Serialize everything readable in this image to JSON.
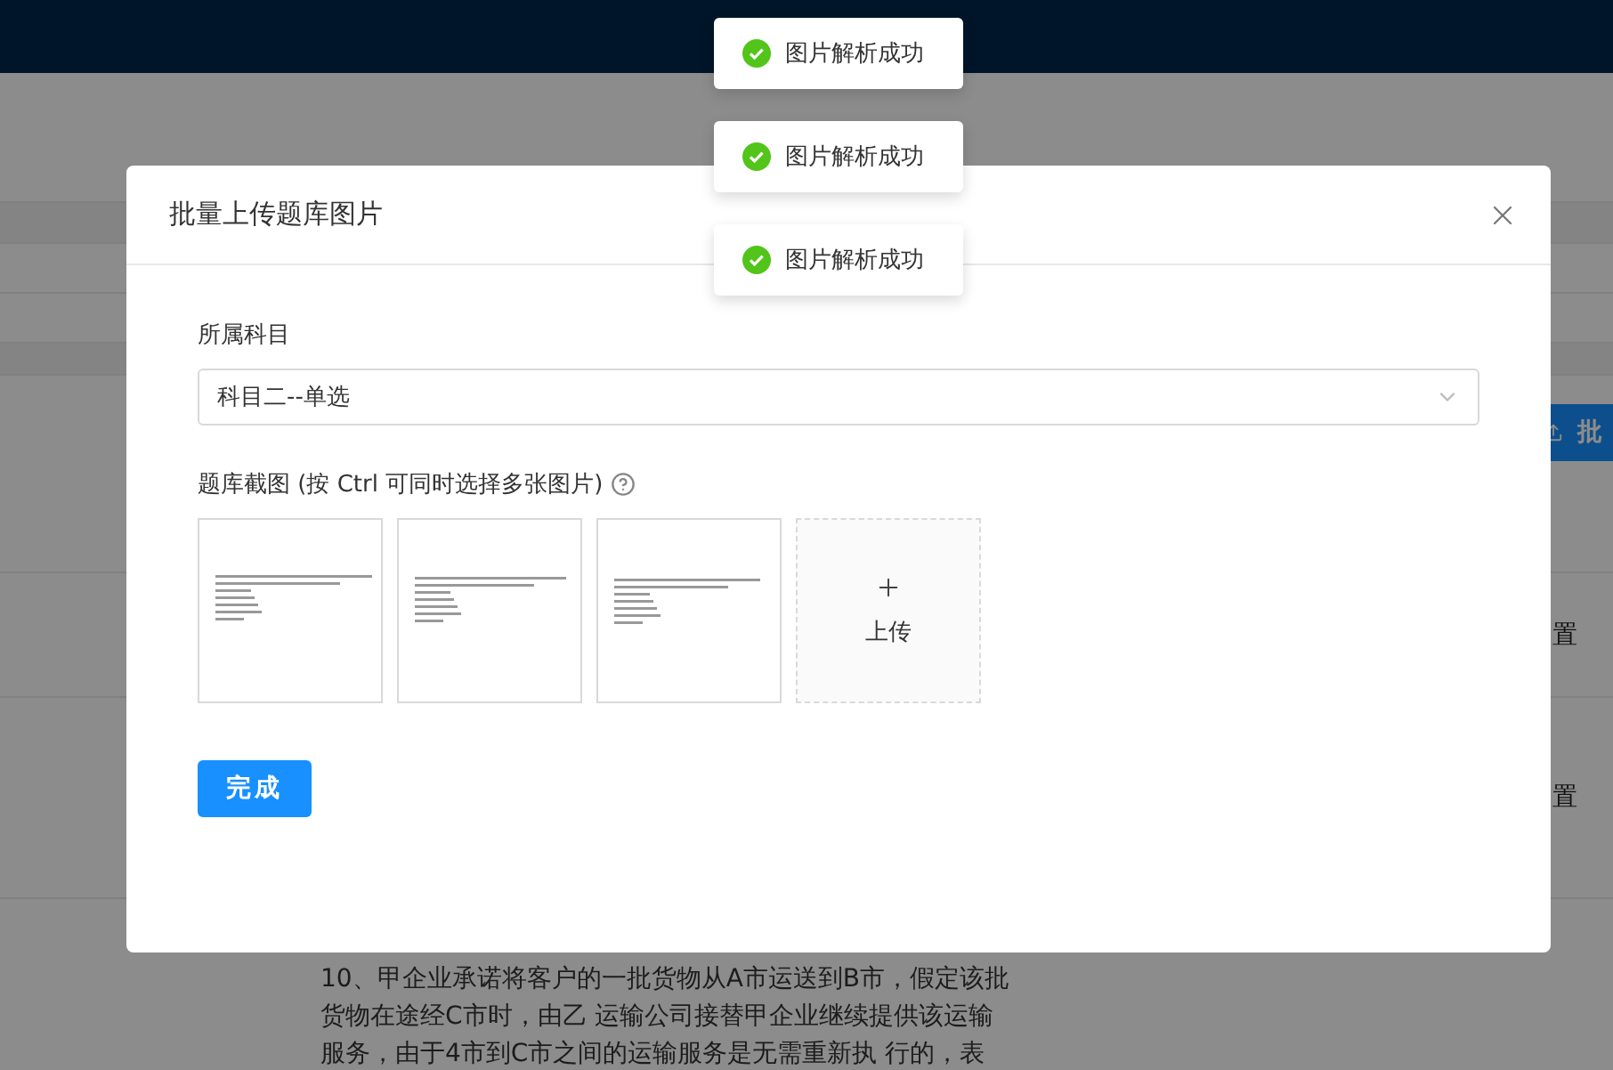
{
  "background": {
    "upload_button": "批",
    "rows": [
      {
        "action": "置"
      },
      {
        "action": "置"
      }
    ],
    "question": "10、甲企业承诺将客户的一批货物从A市运送到B市，假定该批货物在途经C市时，由乙 运输公司接替甲企业继续提供该运输服务，由于4市到C市之间的运输服务是无需重新执 行的，表"
  },
  "modal": {
    "title": "批量上传题库图片",
    "subject_label": "所属科目",
    "subject_value": "科目二--单选",
    "screenshots_label": "题库截图 (按 Ctrl 可同时选择多张图片)",
    "upload_label": "上传",
    "submit": "完成"
  },
  "toasts": [
    {
      "text": "图片解析成功"
    },
    {
      "text": "图片解析成功"
    },
    {
      "text": "图片解析成功"
    }
  ]
}
